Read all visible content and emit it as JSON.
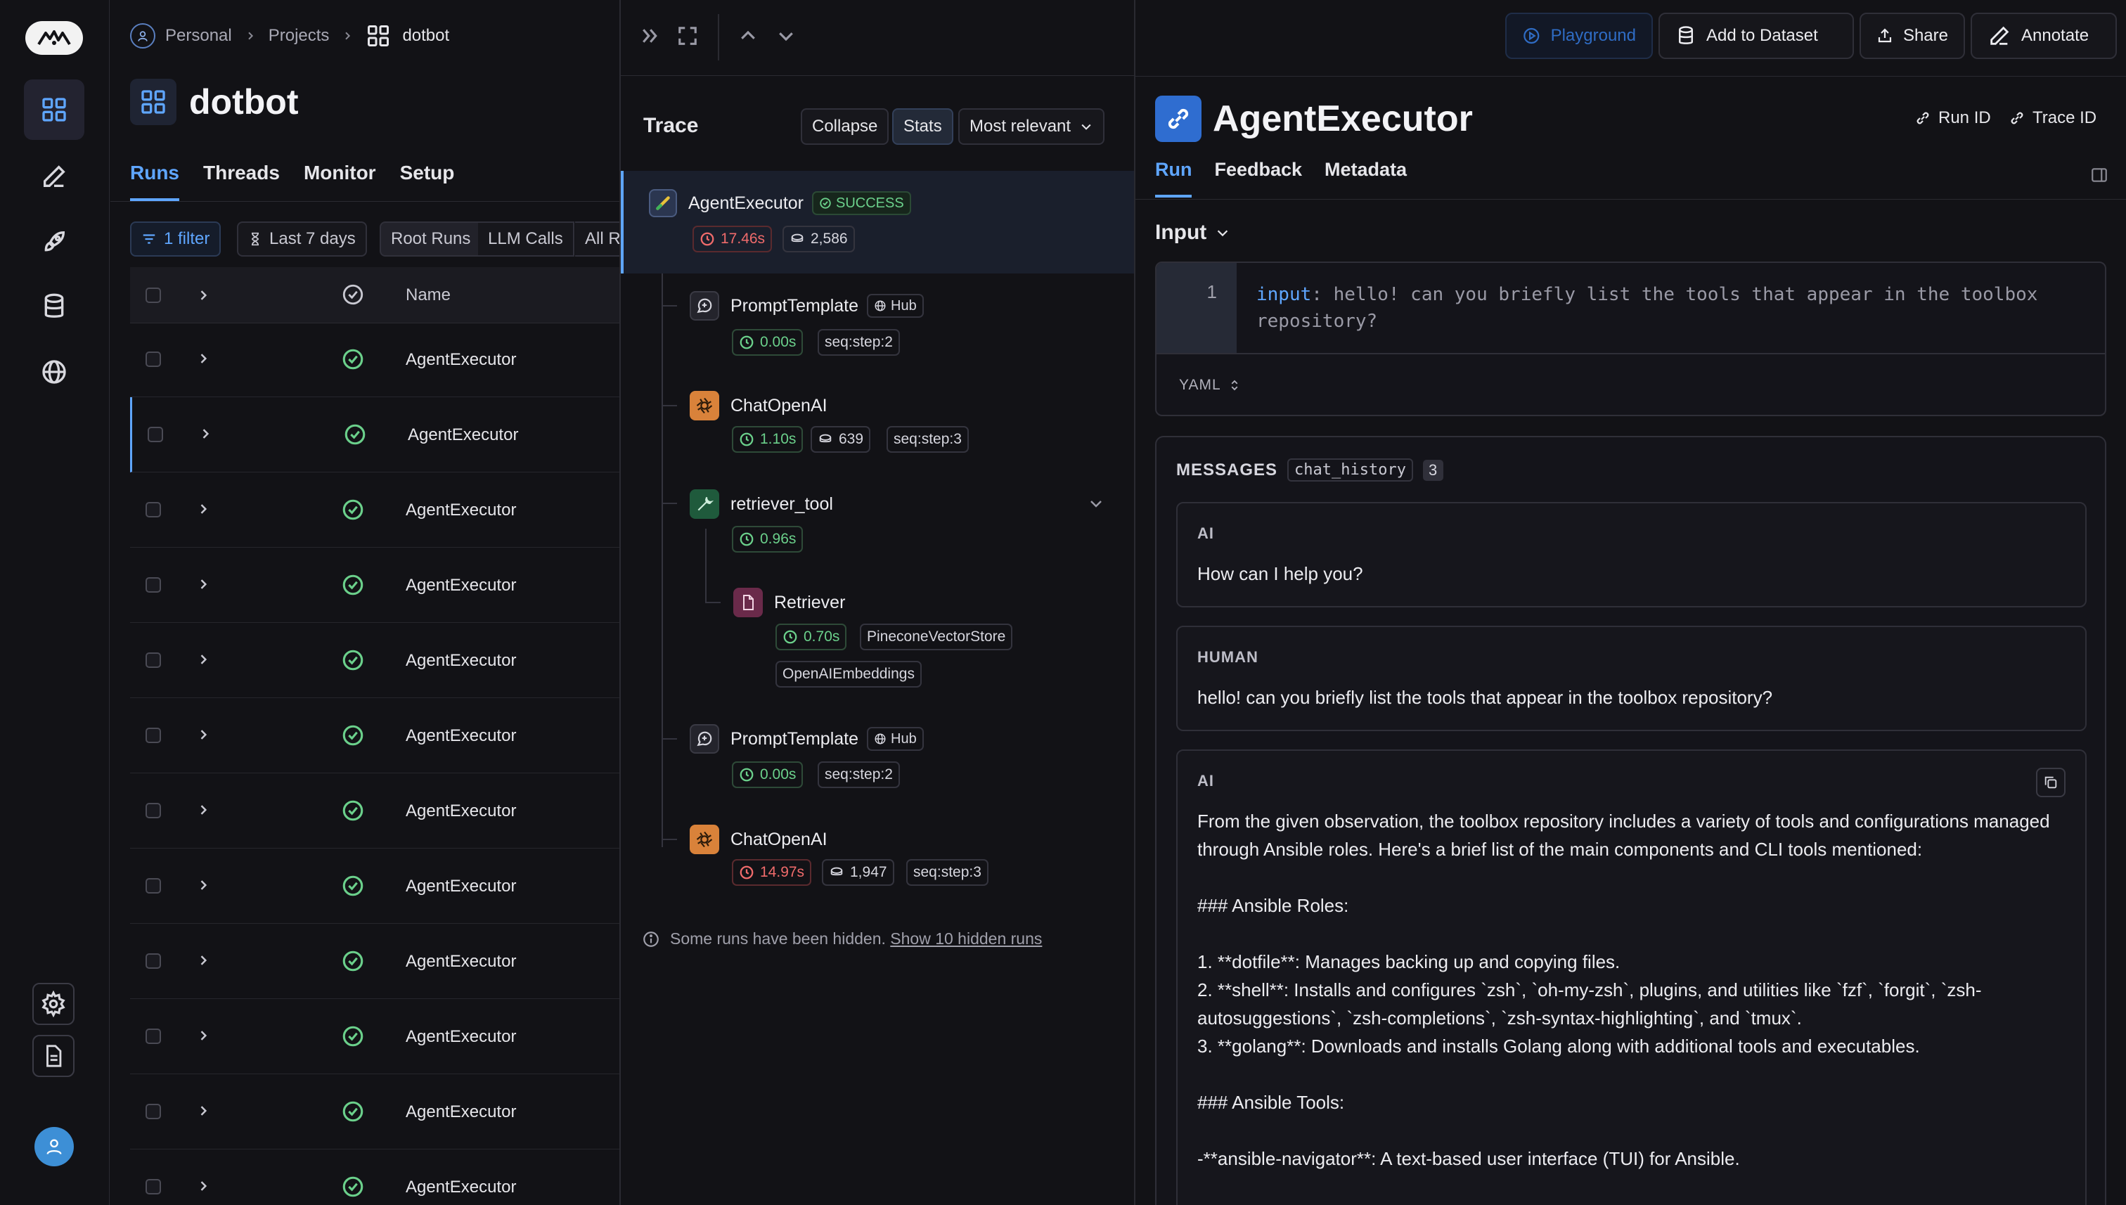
{
  "breadcrumb": {
    "items": [
      "Personal",
      "Projects",
      "dotbot"
    ]
  },
  "project": {
    "title": "dotbot"
  },
  "runs_tabs": [
    "Runs",
    "Threads",
    "Monitor",
    "Setup"
  ],
  "filters": {
    "filter_count": "1 filter",
    "date_range": "Last 7 days",
    "seg_root": "Root Runs",
    "seg_llm": "LLM Calls",
    "seg_all": "All R"
  },
  "table": {
    "name_header": "Name",
    "rows": [
      "AgentExecutor",
      "AgentExecutor",
      "AgentExecutor",
      "AgentExecutor",
      "AgentExecutor",
      "AgentExecutor",
      "AgentExecutor",
      "AgentExecutor",
      "AgentExecutor",
      "AgentExecutor",
      "AgentExecutor",
      "AgentExecutor"
    ]
  },
  "trace": {
    "title": "Trace",
    "collapse": "Collapse",
    "stats": "Stats",
    "sort": "Most relevant",
    "root": {
      "name": "AgentExecutor",
      "status": "SUCCESS",
      "latency": "17.46s",
      "tokens": "2,586"
    },
    "nodes": [
      {
        "name": "PromptTemplate",
        "tag": "Hub",
        "latency": "0.00s",
        "seq": "seq:step:2"
      },
      {
        "name": "ChatOpenAI",
        "latency": "1.10s",
        "tokens": "639",
        "seq": "seq:step:3"
      },
      {
        "name": "retriever_tool",
        "latency": "0.96s"
      },
      {
        "name": "Retriever",
        "latency": "0.70s",
        "tag1": "PineconeVectorStore",
        "tag2": "OpenAIEmbeddings"
      },
      {
        "name": "PromptTemplate",
        "tag": "Hub",
        "latency": "0.00s",
        "seq": "seq:step:2"
      },
      {
        "name": "ChatOpenAI",
        "latency": "14.97s",
        "tokens": "1,947",
        "seq": "seq:step:3"
      }
    ],
    "hidden_note": "Some runs have been hidden.",
    "hidden_link": "Show 10 hidden runs"
  },
  "toolbar": {
    "playground": "Playground",
    "add_dataset": "Add to Dataset",
    "share": "Share",
    "annotate": "Annotate"
  },
  "detail": {
    "title": "AgentExecutor",
    "run_id": "Run ID",
    "trace_id": "Trace ID",
    "tabs": [
      "Run",
      "Feedback",
      "Metadata"
    ],
    "input_label": "Input",
    "code_line_no": "1",
    "code_key": "input",
    "code_value": "hello! can you briefly list the tools that appear in the toolbox repository?",
    "format": "YAML",
    "messages_label": "MESSAGES",
    "messages_key": "chat_history",
    "messages_count": "3",
    "messages": [
      {
        "role": "AI",
        "text": "How can I help you?"
      },
      {
        "role": "HUMAN",
        "text": "hello! can you briefly list the tools that appear in the toolbox repository?"
      },
      {
        "role": "AI",
        "text": "From the given observation, the toolbox repository includes a variety of tools and configurations managed through Ansible roles. Here's a brief list of the main components and CLI tools mentioned:\n\n### Ansible Roles:\n\n1. **dotfile**: Manages backing up and copying files.\n2. **shell**: Installs and configures `zsh`, `oh-my-zsh`, plugins, and utilities like `fzf`, `forgit`, `zsh-autosuggestions`, `zsh-completions`, `zsh-syntax-highlighting`, and `tmux`.\n3. **golang**: Downloads and installs Golang along with additional tools and executables.\n\n### Ansible Tools:\n\n-**ansible-navigator**: A text-based user interface (TUI) for Ansible."
      }
    ]
  },
  "colors": {
    "accent": "#5fa6ff",
    "success": "#6bd08b",
    "danger": "#f06b6b",
    "bg": "#121216"
  }
}
